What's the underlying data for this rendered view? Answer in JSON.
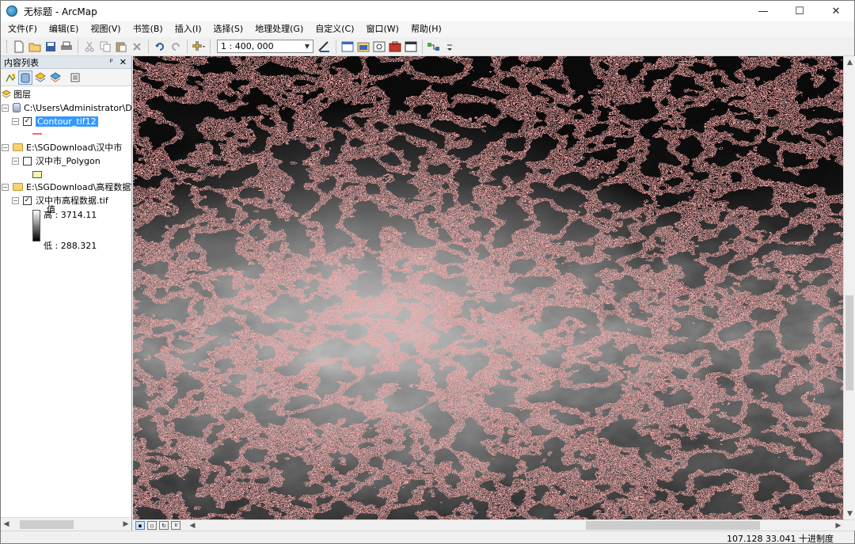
{
  "window": {
    "title": "无标题 - ArcMap",
    "minimize": "—",
    "maximize": "☐",
    "close": "✕"
  },
  "menu": [
    "文件(F)",
    "编辑(E)",
    "视图(V)",
    "书签(B)",
    "插入(I)",
    "选择(S)",
    "地理处理(G)",
    "自定义(C)",
    "窗口(W)",
    "帮助(H)"
  ],
  "toolbar": {
    "scale_value": "1 : 400, 000"
  },
  "toc": {
    "title": "内容列表",
    "pin": "ᵖ",
    "close": "✕",
    "root_label": "图层",
    "items": {
      "db_path": "C:\\Users\\Administrator\\Docu",
      "contour_layer": "Contour_tif12",
      "folder1_path": "E:\\SGDownload\\汉中市",
      "polygon_layer": "汉中市_Polygon",
      "folder2_path": "E:\\SGDownload\\高程数据\\汉中",
      "dem_layer": "汉中市高程数据.tif",
      "value_label": "值",
      "high_label": "高 : 3714.11",
      "low_label": "低 : 288.321"
    }
  },
  "status": {
    "coordinates": "107.128  33.041 十进制度"
  },
  "colors": {
    "contour": "#ff6b6b",
    "selection": "#3399ff"
  }
}
